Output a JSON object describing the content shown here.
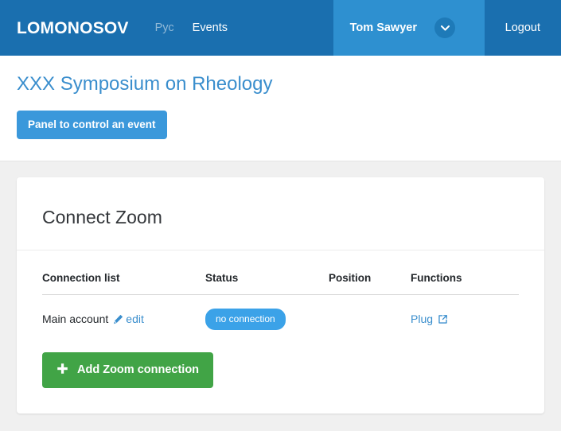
{
  "navbar": {
    "brand": "LOMONOSOV",
    "links": [
      {
        "label": "Рус",
        "name": "nav-link-rus",
        "muted": true
      },
      {
        "label": "Events",
        "name": "nav-link-events",
        "muted": false
      }
    ],
    "user_name": "Tom Sawyer",
    "user_caret_icon": "chevron-down-icon",
    "logout_label": "Logout",
    "colors": {
      "navbar_bg": "#1a6faf",
      "user_bg": "#2e90d0",
      "caret_circle_bg": "#1e7ab8"
    }
  },
  "header": {
    "page_title": "XXX Symposium on Rheology",
    "panel_button_label": "Panel to control an event",
    "panel_button_color": "#3a98db",
    "title_color": "#3a8ecd"
  },
  "card": {
    "title": "Connect Zoom",
    "table": {
      "headers": [
        "Connection list",
        "Status",
        "Position",
        "Functions"
      ],
      "rows": [
        {
          "connection": "Main account",
          "edit_label": "edit",
          "edit_icon": "pencil-icon",
          "status": "no connection",
          "status_color": "#3ba2e8",
          "position": "",
          "function_label": "Plug",
          "function_icon": "external-link-icon"
        }
      ]
    },
    "add_button_label": "Add Zoom connection",
    "add_button_icon": "plus-icon",
    "add_button_color": "#41a446"
  }
}
